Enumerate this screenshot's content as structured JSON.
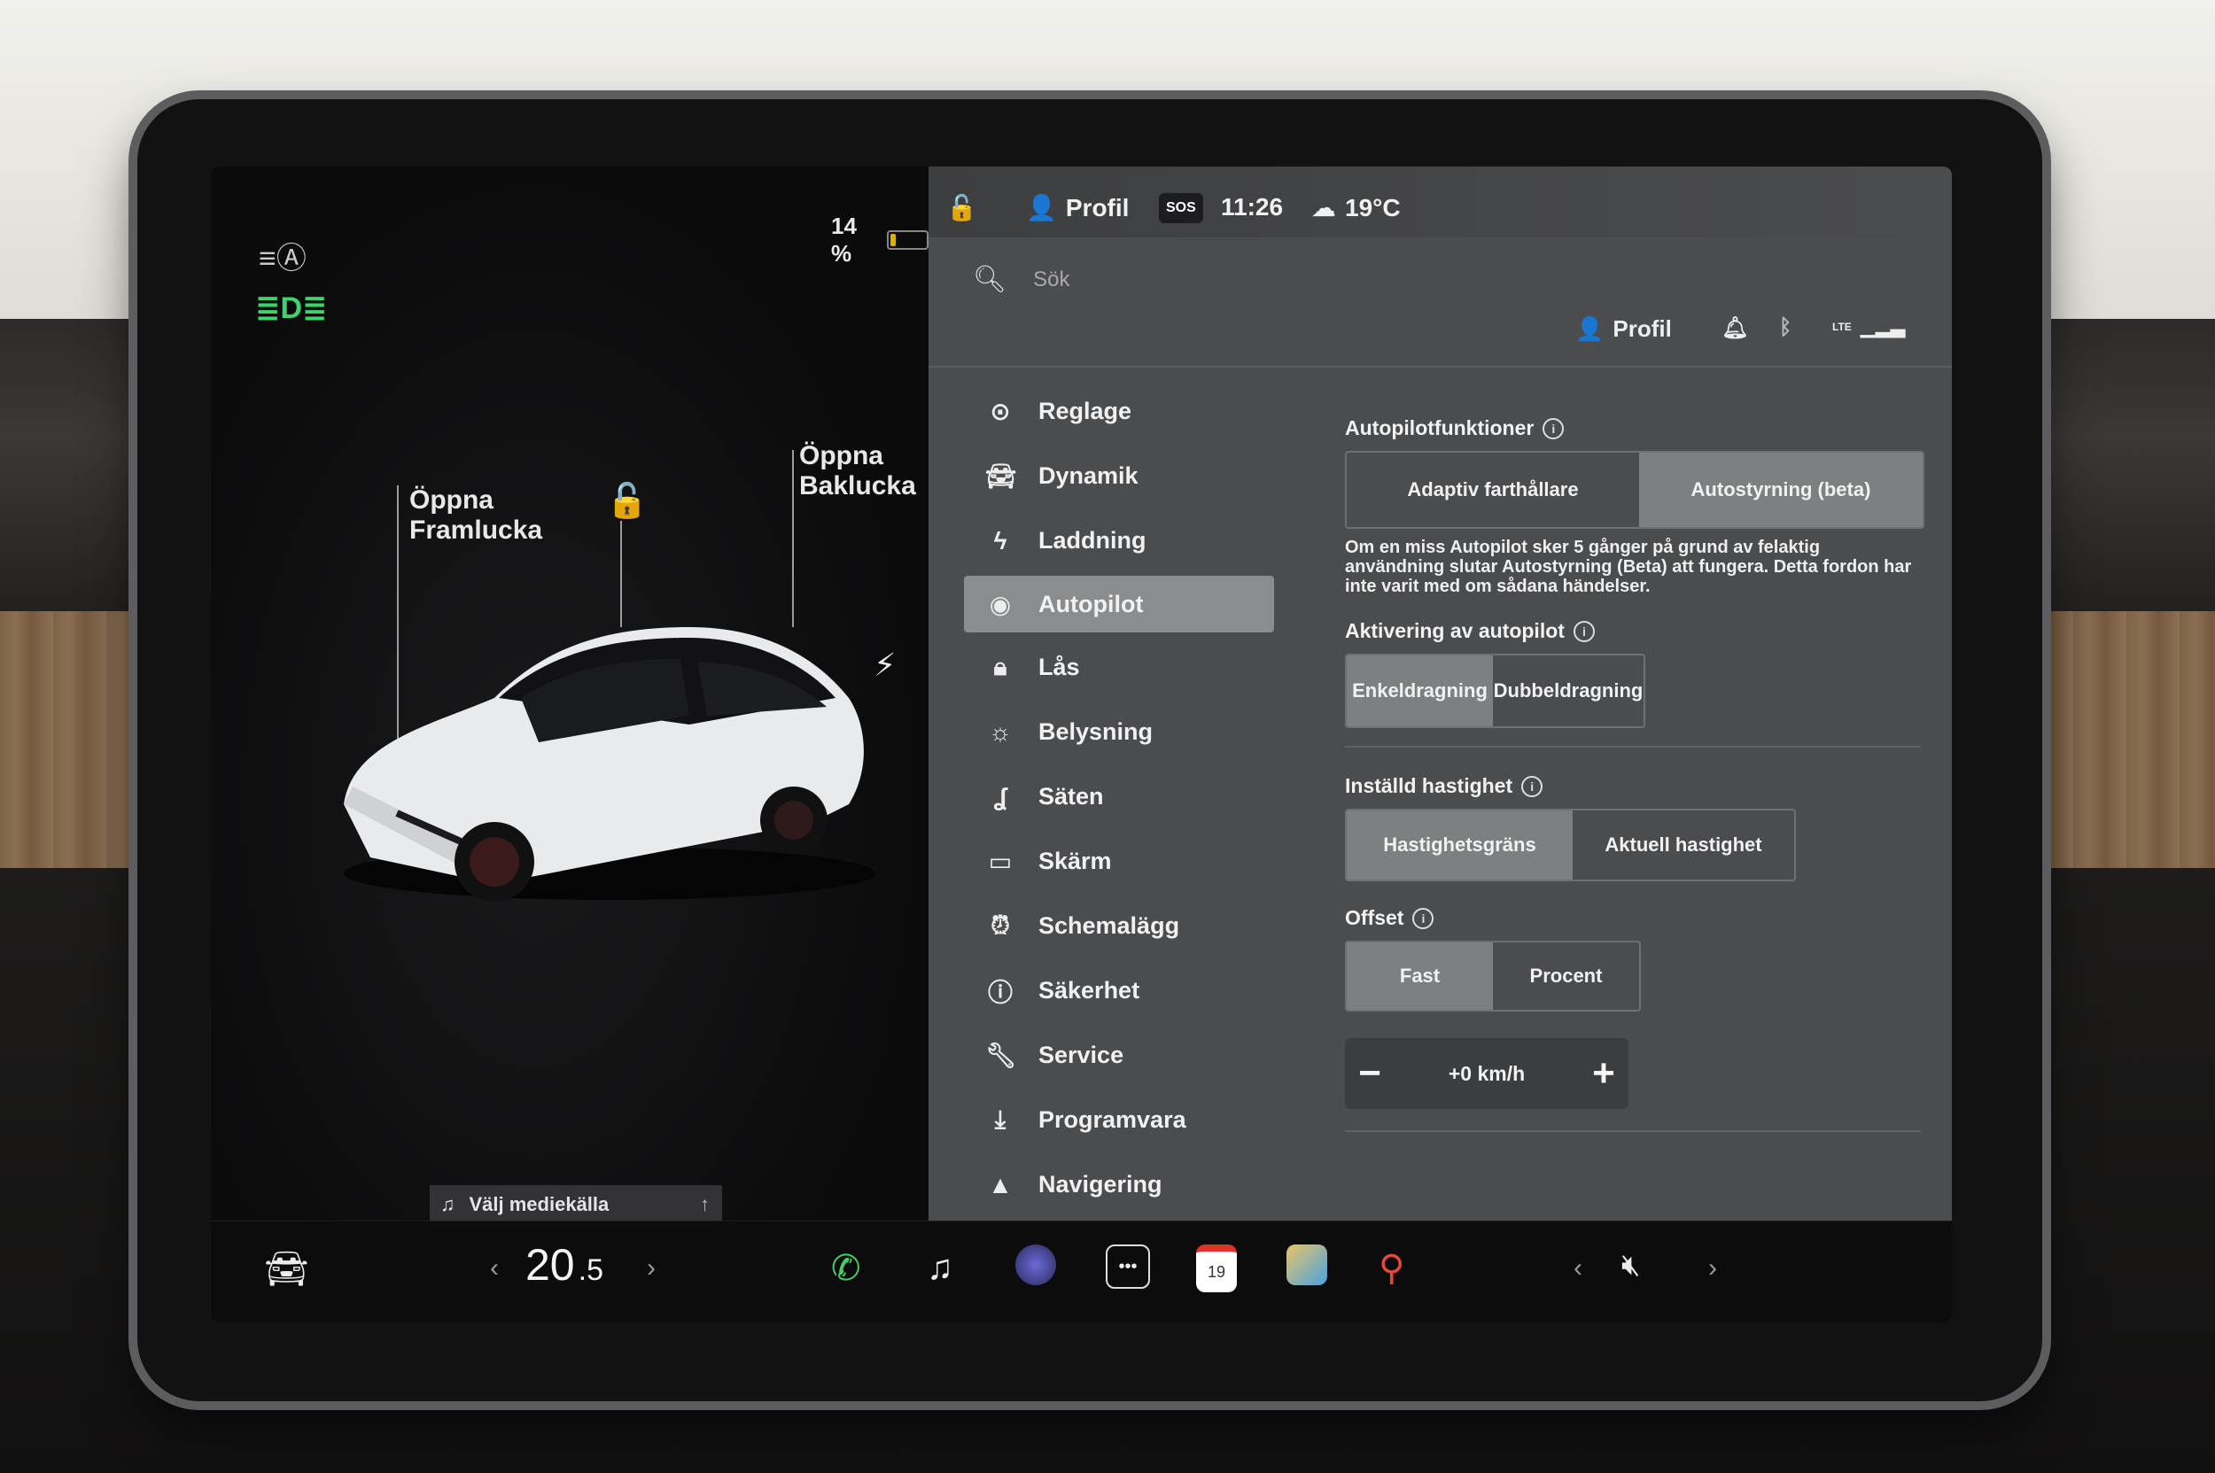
{
  "left": {
    "battery_label": "14 %",
    "battery_level": 0.14,
    "frunk_label_line1": "Öppna",
    "frunk_label_line2": "Framlucka",
    "trunk_label_line1": "Öppna",
    "trunk_label_line2": "Baklucka",
    "media_label": "Välj mediekälla",
    "icons": [
      "auto-headlights-icon",
      "low-beam-icon",
      "unlock-icon",
      "charge-bolt-icon",
      "music-note-icon",
      "arrow-up-icon"
    ]
  },
  "topbar": {
    "profile_label": "Profil",
    "sos_label": "SOS",
    "time": "11:26",
    "temperature": "19°C"
  },
  "search": {
    "placeholder": "Sök"
  },
  "status_right": {
    "profile_label": "Profil",
    "lte_label": "LTE"
  },
  "nav": {
    "items": [
      {
        "label": "Reglage",
        "icon": "toggle-icon"
      },
      {
        "label": "Dynamik",
        "icon": "car-icon"
      },
      {
        "label": "Laddning",
        "icon": "bolt-icon"
      },
      {
        "label": "Autopilot",
        "icon": "steering-wheel-icon"
      },
      {
        "label": "Lås",
        "icon": "lock-icon"
      },
      {
        "label": "Belysning",
        "icon": "sun-icon"
      },
      {
        "label": "Säten",
        "icon": "seat-icon"
      },
      {
        "label": "Skärm",
        "icon": "display-icon"
      },
      {
        "label": "Schemalägg",
        "icon": "alarm-clock-icon"
      },
      {
        "label": "Säkerhet",
        "icon": "alert-circle-icon"
      },
      {
        "label": "Service",
        "icon": "wrench-icon"
      },
      {
        "label": "Programvara",
        "icon": "download-icon"
      },
      {
        "label": "Navigering",
        "icon": "navigation-arrow-icon"
      }
    ],
    "active": "Autopilot"
  },
  "autopilot": {
    "features_title": "Autopilotfunktioner",
    "features_options": [
      "Adaptiv farthållare",
      "Autostyrning (beta)"
    ],
    "features_selected": "Autostyrning (beta)",
    "note": "Om en miss Autopilot sker 5 gånger på grund av felaktig användning slutar Autostyrning (Beta) att fungera. Detta fordon har inte varit med om sådana händelser.",
    "activation_title": "Aktivering av autopilot",
    "activation_options": [
      "Enkeldragning",
      "Dubbeldragning"
    ],
    "activation_selected": "Enkeldragning",
    "speed_title": "Inställd hastighet",
    "speed_options": [
      "Hastighetsgräns",
      "Aktuell hastighet"
    ],
    "speed_selected": "Hastighetsgräns",
    "offset_title": "Offset",
    "offset_options": [
      "Fast",
      "Procent"
    ],
    "offset_selected": "Fast",
    "offset_value": "+0 km/h",
    "minus_label": "−",
    "plus_label": "+"
  },
  "dock": {
    "temp_whole": "20",
    "temp_decimal": ".5",
    "calendar_day": "19",
    "icons": [
      "car-icon",
      "phone-icon",
      "music-icon",
      "camera-icon",
      "more-apps-icon",
      "calendar-icon",
      "photo-app-icon",
      "joystick-icon",
      "volume-mute-icon"
    ]
  },
  "colors": {
    "accent_green": "#3ed36b",
    "pane_bg": "#4b4c4e",
    "selected_bg": "#7d8081",
    "active_nav_bg": "#8a8c8e"
  }
}
